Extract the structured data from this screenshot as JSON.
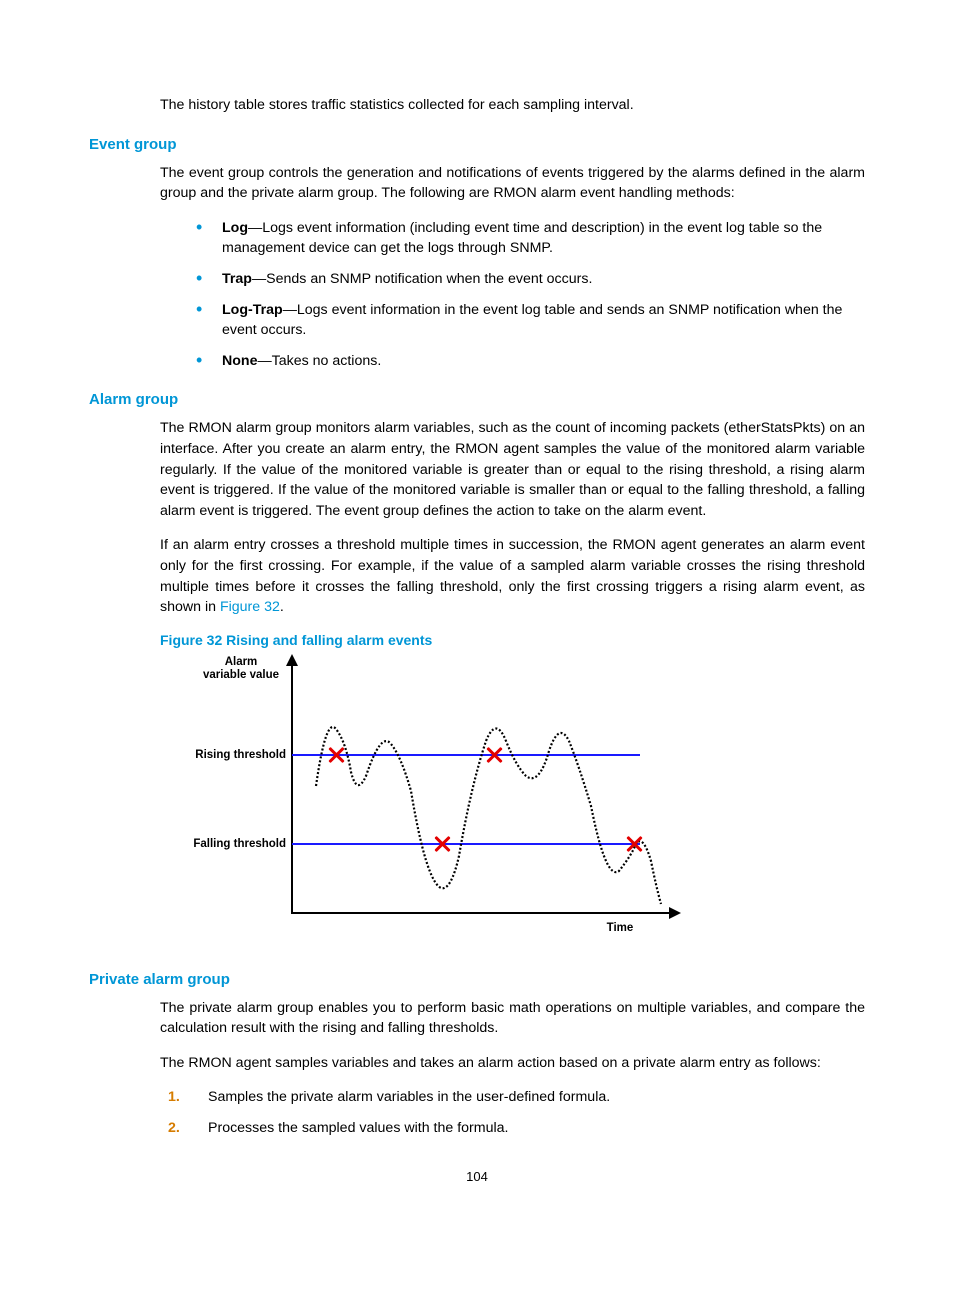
{
  "intro_line": "The history table stores traffic statistics collected for each sampling interval.",
  "event_group": {
    "heading": "Event group",
    "para": "The event group controls the generation and notifications of events triggered by the alarms defined in the alarm group and the private alarm group. The following are RMON alarm event handling methods:",
    "items": {
      "log": {
        "term": "Log",
        "desc": "—Logs event information (including event time and description) in the event log table so the management device can get the logs through SNMP."
      },
      "trap": {
        "term": "Trap",
        "desc": "—Sends an SNMP notification when the event occurs."
      },
      "logtrap": {
        "term": "Log-Trap",
        "desc": "—Logs event information in the event log table and sends an SNMP notification when the event occurs."
      },
      "none": {
        "term": "None",
        "desc": "—Takes no actions."
      }
    }
  },
  "alarm_group": {
    "heading": "Alarm group",
    "p1": "The RMON alarm group monitors alarm variables, such as the count of incoming packets (etherStatsPkts) on an interface. After you create an alarm entry, the RMON agent samples the value of the monitored alarm variable regularly. If the value of the monitored variable is greater than or equal to the rising threshold, a rising alarm event is triggered. If the value of the monitored variable is smaller than or equal to the falling threshold, a falling alarm event is triggered. The event group defines the action to take on the alarm event.",
    "p2a": "If an alarm entry crosses a threshold multiple times in succession, the RMON agent generates an alarm event only for the first crossing. For example, if the value of a sampled alarm variable crosses the rising threshold multiple times before it crosses the falling threshold, only the first crossing triggers a rising alarm event, as shown in ",
    "p2link": "Figure 32",
    "p2b": ".",
    "fig_caption": "Figure 32 Rising and falling alarm events",
    "labels": {
      "yaxis1": "Alarm",
      "yaxis2": "variable value",
      "rising": "Rising threshold",
      "falling": "Falling threshold",
      "time": "Time"
    }
  },
  "private_alarm": {
    "heading": "Private alarm group",
    "p1": "The private alarm group enables you to perform basic math operations on multiple variables, and compare the calculation result with the rising and falling thresholds.",
    "p2": "The RMON agent samples variables and takes an alarm action based on a private alarm entry as follows:",
    "steps": {
      "s1": {
        "num": "1.",
        "text": "Samples the private alarm variables in the user-defined formula."
      },
      "s2": {
        "num": "2.",
        "text": "Processes the sampled values with the formula."
      }
    }
  },
  "page_number": "104",
  "chart_data": {
    "type": "line",
    "title": "Rising and falling alarm events",
    "xlabel": "Time",
    "ylabel": "Alarm variable value",
    "thresholds": {
      "rising": 0.65,
      "falling": 0.3
    },
    "series": [
      {
        "name": "alarm variable",
        "x": [
          0.07,
          0.12,
          0.17,
          0.22,
          0.3,
          0.38,
          0.46,
          0.53,
          0.6,
          0.67,
          0.74,
          0.82,
          0.9,
          0.96
        ],
        "values": [
          0.5,
          0.72,
          0.55,
          0.68,
          0.48,
          0.1,
          0.55,
          0.78,
          0.58,
          0.75,
          0.45,
          0.15,
          0.3,
          0.08
        ]
      }
    ],
    "crossings": [
      {
        "type": "rising",
        "x": 0.12
      },
      {
        "type": "falling",
        "x": 0.4
      },
      {
        "type": "rising",
        "x": 0.53
      },
      {
        "type": "falling",
        "x": 0.88
      }
    ],
    "ylim": [
      0,
      1
    ],
    "xlim": [
      0,
      1
    ]
  }
}
